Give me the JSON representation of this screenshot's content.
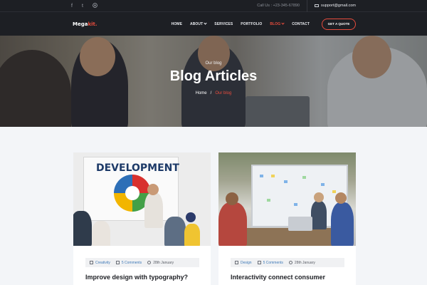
{
  "topbar": {
    "social": [
      "f",
      "t",
      "gh"
    ],
    "call": "Call Us : +23-345-67890",
    "email": "support@gmail.com"
  },
  "nav": {
    "logo_main": "Mega",
    "logo_accent": "kit.",
    "items": [
      {
        "label": "HOME",
        "dropdown": false,
        "active": false
      },
      {
        "label": "ABOUT",
        "dropdown": true,
        "active": false
      },
      {
        "label": "SERVICES",
        "dropdown": false,
        "active": false
      },
      {
        "label": "PORTFOLIO",
        "dropdown": false,
        "active": false
      },
      {
        "label": "BLOG",
        "dropdown": true,
        "active": true
      },
      {
        "label": "CONTACT",
        "dropdown": false,
        "active": false
      }
    ],
    "cta": "GET A QUOTE"
  },
  "hero": {
    "kicker": "Our blog",
    "title": "Blog Articles",
    "breadcrumb_home": "Home",
    "breadcrumb_sep": "/",
    "breadcrumb_current": "Our blog"
  },
  "cards": [
    {
      "category": "Creativity",
      "comments": "5 Comments",
      "date": "28th January",
      "title": "Improve design with typography?",
      "board_text": "DEVELOPMENT"
    },
    {
      "category": "Design",
      "comments": "5 Comments",
      "date": "28th January",
      "title": "Interactivity connect consumer"
    }
  ],
  "colors": {
    "accent": "#e84c3d",
    "dark": "#1d1f24",
    "link": "#3f7ab8"
  }
}
